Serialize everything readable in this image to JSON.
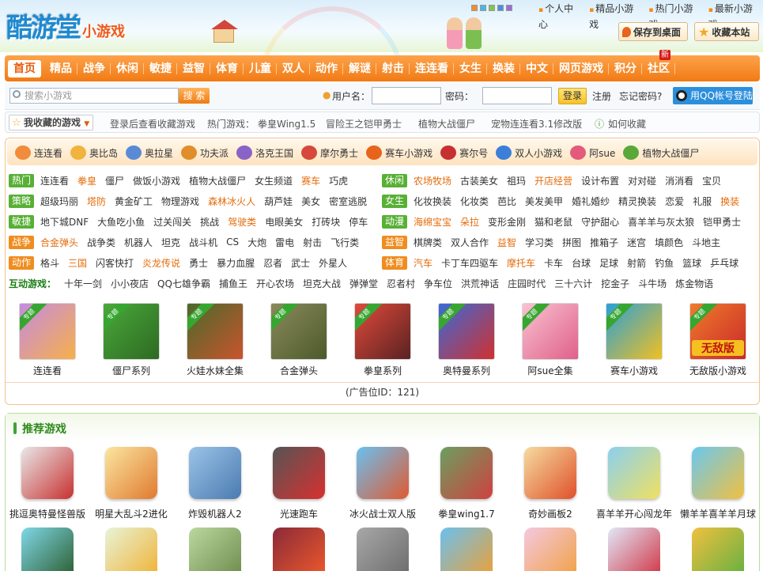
{
  "header": {
    "logo_main": "酷游堂",
    "logo_sub": "小游戏",
    "top_links": [
      "个人中心",
      "精品小游戏",
      "热门小游戏",
      "最新小游戏"
    ],
    "save_desktop": "保存到桌面",
    "bookmark": "收藏本站",
    "skin_colors": [
      "#f48c2a",
      "#45b7e8",
      "#86c44a",
      "#4b8ee0",
      "#a06bd6"
    ]
  },
  "nav": {
    "items": [
      "首页",
      "精品",
      "战争",
      "休闲",
      "敏捷",
      "益智",
      "体育",
      "儿童",
      "双人",
      "动作",
      "解谜",
      "射击",
      "连连看",
      "女生",
      "换装",
      "中文",
      "网页游戏",
      "积分",
      "社区"
    ],
    "new_badge": "新",
    "accent": "#f17a14"
  },
  "login": {
    "search_placeholder": "搜索小游戏",
    "search_btn": "搜 索",
    "username_label": "用户名：",
    "password_label": "密码：",
    "login_btn": "登录",
    "register": "注册",
    "forgot": "忘记密码?",
    "qq_login": "用QQ帐号登陆"
  },
  "favbar": {
    "fav_label": "我收藏的游戏",
    "hint": "登录后查看收藏游戏",
    "hot_label": "热门游戏：",
    "hot_games": [
      "拳皇Wing1.5",
      "冒险王之铠甲勇士",
      "植物大战僵尸",
      "宠物连连看3.1修改版"
    ],
    "howto": "如何收藏"
  },
  "quickbar": [
    {
      "label": "连连看",
      "color": "#f08c3c"
    },
    {
      "label": "奥比岛",
      "color": "#f2b33d"
    },
    {
      "label": "奥拉星",
      "color": "#5a8ad6"
    },
    {
      "label": "功夫派",
      "color": "#e08e2a"
    },
    {
      "label": "洛克王国",
      "color": "#8a63c7"
    },
    {
      "label": "摩尔勇士",
      "color": "#d5483b"
    },
    {
      "label": "赛车小游戏",
      "color": "#e8631c"
    },
    {
      "label": "赛尔号",
      "color": "#c73030"
    },
    {
      "label": "双人小游戏",
      "color": "#3c7fd8"
    },
    {
      "label": "阿sue",
      "color": "#e45a7a"
    },
    {
      "label": "植物大战僵尸",
      "color": "#5aa83a"
    }
  ],
  "categories_left": [
    {
      "tag": "热门",
      "color": "#58b035",
      "items": [
        {
          "t": "连连看"
        },
        {
          "t": "拳皇",
          "hl": true
        },
        {
          "t": "僵尸"
        },
        {
          "t": "做饭小游戏"
        },
        {
          "t": "植物大战僵尸"
        },
        {
          "t": "女生频道"
        },
        {
          "t": "赛车",
          "hl": true
        },
        {
          "t": "巧虎"
        }
      ]
    },
    {
      "tag": "策略",
      "color": "#58b035",
      "items": [
        {
          "t": "超级玛丽"
        },
        {
          "t": "塔防",
          "hl": true
        },
        {
          "t": "黄金矿工"
        },
        {
          "t": "物理游戏"
        },
        {
          "t": "森林冰火人",
          "hl": true
        },
        {
          "t": "葫芦娃"
        },
        {
          "t": "美女"
        },
        {
          "t": "密室逃脱"
        }
      ]
    },
    {
      "tag": "敏捷",
      "color": "#58b035",
      "items": [
        {
          "t": "地下城DNF"
        },
        {
          "t": "大鱼吃小鱼"
        },
        {
          "t": "过关闯关"
        },
        {
          "t": "挑战"
        },
        {
          "t": "驾驶类",
          "hl": true
        },
        {
          "t": "电眼美女"
        },
        {
          "t": "打砖块"
        },
        {
          "t": "停车"
        }
      ]
    },
    {
      "tag": "战争",
      "color": "#f08d1f",
      "items": [
        {
          "t": "合金弹头",
          "hl": true
        },
        {
          "t": "战争类"
        },
        {
          "t": "机器人"
        },
        {
          "t": "坦克"
        },
        {
          "t": "战斗机"
        },
        {
          "t": "CS"
        },
        {
          "t": "大炮"
        },
        {
          "t": "雷电"
        },
        {
          "t": "射击"
        },
        {
          "t": "飞行类"
        }
      ]
    },
    {
      "tag": "动作",
      "color": "#f08d1f",
      "items": [
        {
          "t": "格斗"
        },
        {
          "t": "三国",
          "hl": true
        },
        {
          "t": "闪客快打"
        },
        {
          "t": "炎龙传说",
          "hl": true
        },
        {
          "t": "勇士"
        },
        {
          "t": "暴力血腥"
        },
        {
          "t": "忍者"
        },
        {
          "t": "武士"
        },
        {
          "t": "外星人"
        }
      ]
    }
  ],
  "categories_right": [
    {
      "tag": "休闲",
      "color": "#58b035",
      "items": [
        {
          "t": "农场牧场",
          "hl": true
        },
        {
          "t": "古装美女"
        },
        {
          "t": "祖玛"
        },
        {
          "t": "开店经营",
          "hl": true
        },
        {
          "t": "设计布置"
        },
        {
          "t": "对对碰"
        },
        {
          "t": "消消看"
        },
        {
          "t": "宝贝"
        }
      ]
    },
    {
      "tag": "女生",
      "color": "#58b035",
      "items": [
        {
          "t": "化妆换装"
        },
        {
          "t": "化妆类"
        },
        {
          "t": "芭比"
        },
        {
          "t": "美发美甲"
        },
        {
          "t": "婚礼婚纱"
        },
        {
          "t": "精灵换装"
        },
        {
          "t": "恋爱"
        },
        {
          "t": "礼服"
        },
        {
          "t": "换装",
          "hl": true
        }
      ]
    },
    {
      "tag": "动漫",
      "color": "#58b035",
      "items": [
        {
          "t": "海绵宝宝",
          "hl": true
        },
        {
          "t": "朵拉",
          "hl": true
        },
        {
          "t": "变形金刚"
        },
        {
          "t": "猫和老鼠"
        },
        {
          "t": "守护甜心"
        },
        {
          "t": "喜羊羊与灰太狼"
        },
        {
          "t": "铠甲勇士"
        }
      ]
    },
    {
      "tag": "益智",
      "color": "#f08d1f",
      "items": [
        {
          "t": "棋牌类"
        },
        {
          "t": "双人合作"
        },
        {
          "t": "益智",
          "hl": true
        },
        {
          "t": "学习类"
        },
        {
          "t": "拼图"
        },
        {
          "t": "推箱子"
        },
        {
          "t": "迷宫"
        },
        {
          "t": "填颜色"
        },
        {
          "t": "斗地主"
        }
      ]
    },
    {
      "tag": "体育",
      "color": "#f08d1f",
      "items": [
        {
          "t": "汽车",
          "hl": true
        },
        {
          "t": "卡丁车四驱车"
        },
        {
          "t": "摩托车",
          "hl": true
        },
        {
          "t": "卡车"
        },
        {
          "t": "台球"
        },
        {
          "t": "足球"
        },
        {
          "t": "射箭"
        },
        {
          "t": "钓鱼"
        },
        {
          "t": "篮球"
        },
        {
          "t": "乒乓球"
        }
      ]
    }
  ],
  "interactive": {
    "label": "互动游戏：",
    "items": [
      "十年一剑",
      "小小夜店",
      "QQ七雄争霸",
      "捕鱼王",
      "开心农场",
      "坦克大战",
      "弹弹堂",
      "忍者村",
      "争车位",
      "洪荒神话",
      "庄园时代",
      "三十六计",
      "挖金子",
      "斗牛场",
      "炼金物语"
    ]
  },
  "special_tiles": {
    "ribbon": "专题",
    "items": [
      {
        "label": "连连看",
        "c1": "#c58be0",
        "c2": "#f6b04a"
      },
      {
        "label": "僵尸系列",
        "c1": "#4aa83a",
        "c2": "#2d6a22"
      },
      {
        "label": "火娃水妹全集",
        "c1": "#4a6a2a",
        "c2": "#c9542e"
      },
      {
        "label": "合金弹头",
        "c1": "#8a8a5a",
        "c2": "#4c5a2c"
      },
      {
        "label": "拳皇系列",
        "c1": "#e04a3a",
        "c2": "#5a2222"
      },
      {
        "label": "奥特曼系列",
        "c1": "#3a6ad6",
        "c2": "#d03030"
      },
      {
        "label": "阿sue全集",
        "c1": "#f8c2d2",
        "c2": "#e0608a"
      },
      {
        "label": "赛车小游戏",
        "c1": "#2aa0d8",
        "c2": "#f0c020"
      },
      {
        "label": "无敌版小游戏",
        "c1": "#f07a2a",
        "c2": "#c82a2a",
        "extra": "无敌版"
      }
    ]
  },
  "ad_text": "(广告位ID：121)",
  "recommend": {
    "title": "推荐游戏",
    "items": [
      {
        "label": "挑逗奥特曼怪兽版",
        "c1": "#e8e8e8",
        "c2": "#c83030"
      },
      {
        "label": "明星大乱斗2进化",
        "c1": "#fbe6a0",
        "c2": "#e07a30"
      },
      {
        "label": "炸毁机器人2",
        "c1": "#9bc4e8",
        "c2": "#4a7ab0"
      },
      {
        "label": "光速跑车",
        "c1": "#555",
        "c2": "#d83030"
      },
      {
        "label": "冰火战士双人版",
        "c1": "#6ac0f0",
        "c2": "#e05a30"
      },
      {
        "label": "拳皇wing1.7",
        "c1": "#6aa060",
        "c2": "#d04040"
      },
      {
        "label": "奇妙画板2",
        "c1": "#f5dca0",
        "c2": "#e0502a"
      },
      {
        "label": "喜羊羊开心闯龙年",
        "c1": "#8ad0f0",
        "c2": "#f0e060"
      },
      {
        "label": "懒羊羊喜羊羊月球",
        "c1": "#6ac8f0",
        "c2": "#f0c040"
      }
    ],
    "row2_colors": [
      [
        "#7fd8e8",
        "#2a5a2a"
      ],
      [
        "#e8f4d8",
        "#f0b030"
      ],
      [
        "#bcd8a0",
        "#6a8a4a"
      ],
      [
        "#8a2a3a",
        "#f05a2a"
      ],
      [
        "#a8a8a8",
        "#6a6a6a"
      ],
      [
        "#6ac0f0",
        "#f0a030"
      ],
      [
        "#f5c8e0",
        "#f0a040"
      ],
      [
        "#e0e8f8",
        "#d03040"
      ],
      [
        "#f0c040",
        "#60b040"
      ]
    ]
  }
}
